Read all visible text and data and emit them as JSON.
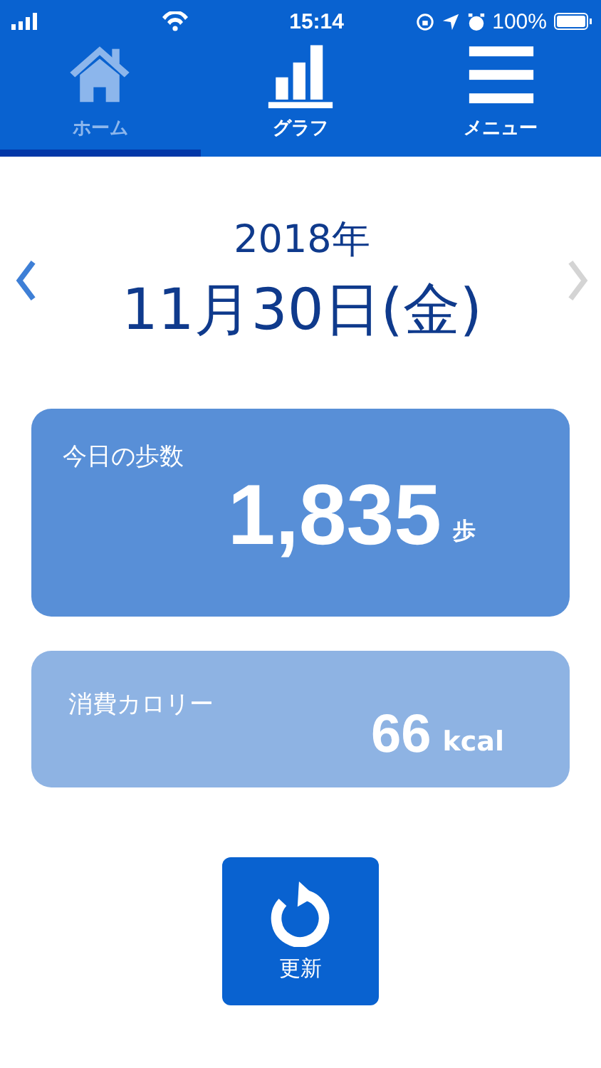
{
  "status_bar": {
    "time": "15:14",
    "battery": "100%"
  },
  "tabs": [
    {
      "kind": "home",
      "label": "ホーム",
      "selected": true
    },
    {
      "kind": "graph",
      "label": "グラフ",
      "selected": false
    },
    {
      "kind": "menu",
      "label": "メニュー",
      "selected": false
    }
  ],
  "date_nav": {
    "year": "2018年",
    "date": "11月30日(金)",
    "prev": {
      "disabled": false
    },
    "next": {
      "disabled": true
    }
  },
  "cards": [
    {
      "kind": "primary",
      "label": "今日の歩数",
      "value": "1,835",
      "unit": "歩"
    },
    {
      "kind": "secondary",
      "label": "消費カロリー",
      "value": "66",
      "unit": "kcal"
    }
  ],
  "refresh_button": {
    "label": "更新"
  }
}
